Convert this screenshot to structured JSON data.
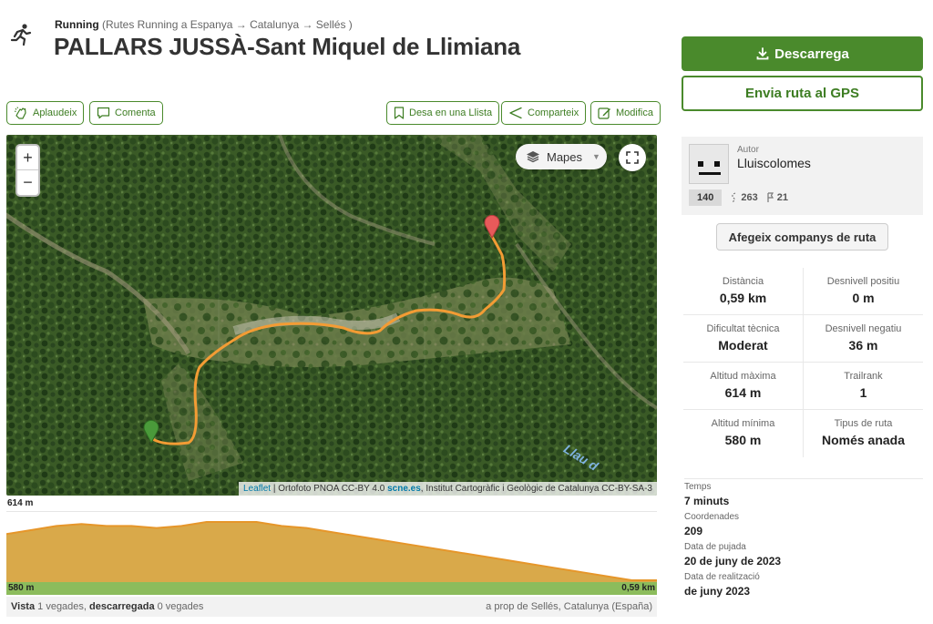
{
  "header": {
    "activity": "Running",
    "breadcrumb": "(Rutes Running a Espanya → Catalunya → Sellés )",
    "title": "PALLARS JUSSÀ-Sant Miquel de Llimiana"
  },
  "actions": {
    "applaud": "Aplaudeix",
    "comment": "Comenta",
    "save_list": "Desa en una Llista",
    "share": "Comparteix",
    "edit": "Modifica"
  },
  "map": {
    "layers_label": "Mapes",
    "zoom_in": "+",
    "zoom_out": "−",
    "water_label": "Llau d",
    "attribution": {
      "leaflet": "Leaflet",
      "sep1": " | Ortofoto PNOA CC-BY 4.0 ",
      "scne": "scne.es",
      "rest": ", Institut Cartogràfic i Geològic de Catalunya CC-BY-SA-3"
    },
    "route_color": "#f39c34",
    "start_marker_color": "#4a9a3a",
    "end_marker_color": "#e85a5a"
  },
  "elevation": {
    "max_label": "614 m",
    "min_label": "580 m",
    "distance_label": "0,59 km",
    "profile_m": [
      603,
      605,
      607,
      608,
      607,
      607,
      606,
      607,
      609,
      609,
      609,
      607,
      606,
      604,
      602,
      600,
      598,
      596,
      594,
      592,
      590,
      588,
      586,
      584,
      582,
      580,
      580
    ]
  },
  "footer": {
    "views_label": "Vista",
    "views_value": " 1 vegades, ",
    "downloads_label": "descarregada",
    "downloads_value": " 0 vegades",
    "location": "a prop de Sellés, Catalunya (España)"
  },
  "sidebar": {
    "download": "Descarrega",
    "send_gps": "Envia ruta al GPS",
    "author_label": "Autor",
    "author_name": "Lluiscolomes",
    "author_badge": "140",
    "author_trails": "263",
    "author_followers": "21",
    "companions": "Afegeix companys de ruta"
  },
  "stats": [
    {
      "label": "Distància",
      "value": "0,59 km"
    },
    {
      "label": "Desnivell positiu",
      "value": "0 m"
    },
    {
      "label": "Dificultat tècnica",
      "value": "Moderat"
    },
    {
      "label": "Desnivell negatiu",
      "value": "36 m"
    },
    {
      "label": "Altitud màxima",
      "value": "614 m"
    },
    {
      "label": "Trailrank",
      "value": "1"
    },
    {
      "label": "Altitud mínima",
      "value": "580 m"
    },
    {
      "label": "Tipus de ruta",
      "value": "Només anada"
    }
  ],
  "details": {
    "time_label": "Temps",
    "time_value": "7 minuts",
    "coords_label": "Coordenades",
    "coords_value": "209",
    "upload_label": "Data de pujada",
    "upload_value": "20 de juny de 2023",
    "done_label": "Data de realització",
    "done_value": "de juny 2023"
  },
  "colors": {
    "brand_green": "#4a8a2c",
    "elevation_fill": "#d9a94a",
    "elevation_base": "#8cbc5c"
  }
}
